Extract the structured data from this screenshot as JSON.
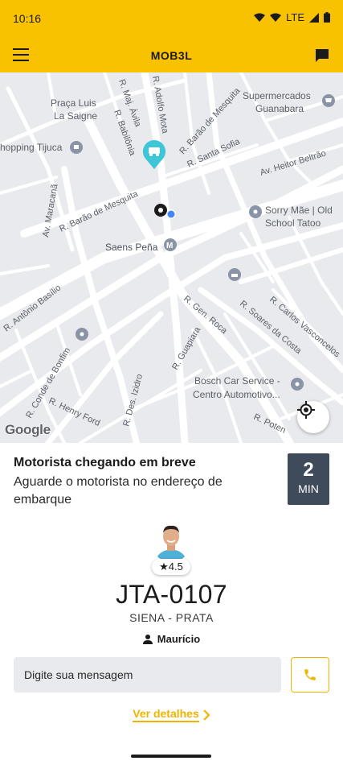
{
  "status_bar": {
    "time": "10:16",
    "network": "LTE",
    "icons": [
      "wifi-icon",
      "signal-icon",
      "battery-icon"
    ]
  },
  "app_bar": {
    "title": "MOB3L",
    "menu_icon": "menu-icon",
    "chat_icon": "chat-icon"
  },
  "map": {
    "attribution": "Google",
    "labels": {
      "praca": "Praça Luis",
      "praca2": "La Saigne",
      "majavila": "R. Maj. Ávila",
      "babilonia": "R. Babilônia",
      "adolfo": "R. Adolfo Mota",
      "baraomesquita1": "R. Barão de Mesquita",
      "supermercados": "Supermercados",
      "guanabara": "Guanabara",
      "shopping": "hopping Tijuca",
      "santasofia": "R. Santa Sofia",
      "heitorbeltrao": "Av. Heitor Beltrão",
      "maracana": "Av. Maracanã",
      "baraomesquita2": "R. Barão de Mesquita",
      "sorry1": "Sorry Mãe | Old",
      "sorry2": "School Tatoo",
      "saenspena": "Saens Peña",
      "antoniobasilio": "R. Antônio Basílio",
      "genroca": "R. Gen. Roca",
      "carlosvasconcelos": "R. Carlos Vasconcelos",
      "soaresdacosta": "R. Soares da Costa",
      "guapiara": "R. Guapiara",
      "bosch1": "Bosch Car Service -",
      "bosch2": "Centro Automotivo...",
      "condebonfim": "R. Conde de Bonfim",
      "henryford": "R. Henry Ford",
      "desizidro": "R. Des. Izidro",
      "poten": "R. Poten"
    },
    "locate_icon": "my-location-icon"
  },
  "arrival": {
    "title": "Motorista chegando em breve",
    "subtitle": "Aguarde o motorista no endereço de embarque",
    "eta_value": "2",
    "eta_unit": "MIN"
  },
  "driver": {
    "rating": "★4.5",
    "plate": "JTA-0107",
    "car": "SIENA - PRATA",
    "name": "Maurício"
  },
  "message": {
    "placeholder": "Digite sua mensagem",
    "value": ""
  },
  "details_link": "Ver detalhes",
  "colors": {
    "brand_yellow": "#f9c201",
    "accent_text": "#f0b400",
    "eta_box": "#3f4a5a",
    "map_bg": "#e8eaed",
    "map_pin_teal": "#3ec6d8"
  }
}
